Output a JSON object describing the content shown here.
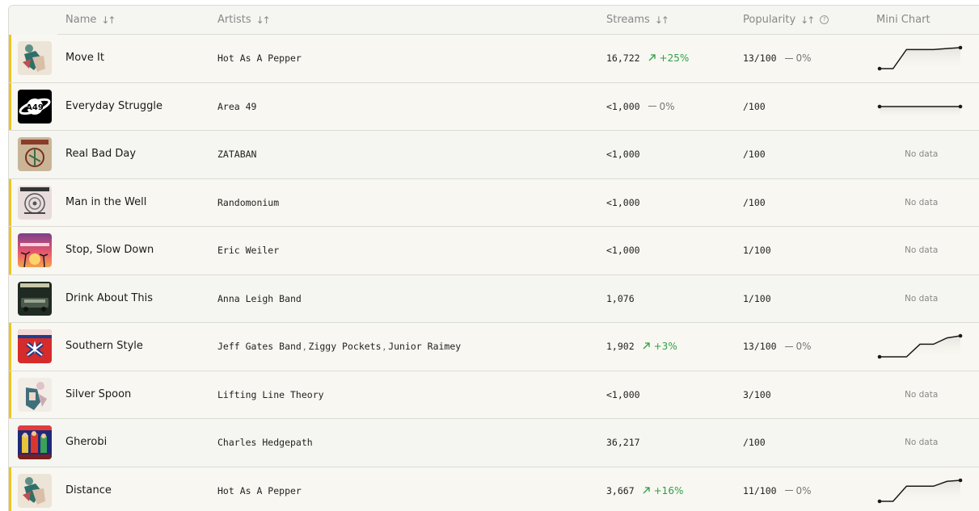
{
  "header": {
    "name": "Name",
    "artists": "Artists",
    "streams": "Streams",
    "popularity": "Popularity",
    "mini_chart": "Mini Chart",
    "info_glyph": "?"
  },
  "no_data_label": "No data",
  "colors": {
    "accent_bar": "#f0c419",
    "positive": "#2f9e4a",
    "row_shaded": "#f8f7f1",
    "row_plain": "#f5f5f2"
  },
  "rows": [
    {
      "name": "Move It",
      "artists": [
        "Hot As A Pepper"
      ],
      "streams": "16,722",
      "streams_change": "+25%",
      "streams_trend": "up",
      "popularity": "13/100",
      "popularity_change": "0%",
      "chart": [
        0.0,
        0.0,
        1.0,
        1.0,
        1.0,
        1.05,
        1.1
      ],
      "highlight": true
    },
    {
      "name": "Everyday Struggle",
      "artists": [
        "Area 49"
      ],
      "streams": "<1,000",
      "streams_change": "0%",
      "streams_trend": "flat",
      "popularity": "/100",
      "popularity_change": "",
      "chart": [
        0.5,
        0.5
      ],
      "highlight": true
    },
    {
      "name": "Real Bad Day",
      "artists": [
        "ZATABAN"
      ],
      "streams": "<1,000",
      "streams_change": "",
      "streams_trend": "",
      "popularity": "/100",
      "popularity_change": "",
      "chart": null,
      "highlight": false
    },
    {
      "name": "Man in the Well",
      "artists": [
        "Randomonium"
      ],
      "streams": "<1,000",
      "streams_change": "",
      "streams_trend": "",
      "popularity": "/100",
      "popularity_change": "",
      "chart": null,
      "highlight": true
    },
    {
      "name": "Stop, Slow Down",
      "artists": [
        "Eric Weiler"
      ],
      "streams": "<1,000",
      "streams_change": "",
      "streams_trend": "",
      "popularity": "1/100",
      "popularity_change": "",
      "chart": null,
      "highlight": true
    },
    {
      "name": "Drink About This",
      "artists": [
        "Anna Leigh Band"
      ],
      "streams": "1,076",
      "streams_change": "",
      "streams_trend": "",
      "popularity": "1/100",
      "popularity_change": "",
      "chart": null,
      "highlight": false
    },
    {
      "name": "Southern Style",
      "artists": [
        "Jeff Gates Band",
        "Ziggy Pockets",
        "Junior Raimey"
      ],
      "streams": "1,902",
      "streams_change": "+3%",
      "streams_trend": "up",
      "popularity": "13/100",
      "popularity_change": "0%",
      "chart": [
        0.0,
        0.0,
        0.0,
        0.6,
        0.6,
        0.9,
        1.0
      ],
      "highlight": true
    },
    {
      "name": "Silver Spoon",
      "artists": [
        "Lifting Line Theory"
      ],
      "streams": "<1,000",
      "streams_change": "",
      "streams_trend": "",
      "popularity": "3/100",
      "popularity_change": "",
      "chart": null,
      "highlight": true
    },
    {
      "name": "Gherobi",
      "artists": [
        "Charles Hedgepath"
      ],
      "streams": "36,217",
      "streams_change": "",
      "streams_trend": "",
      "popularity": "/100",
      "popularity_change": "",
      "chart": null,
      "highlight": false
    },
    {
      "name": "Distance",
      "artists": [
        "Hot As A Pepper"
      ],
      "streams": "3,667",
      "streams_change": "+16%",
      "streams_trend": "up",
      "popularity": "11/100",
      "popularity_change": "0%",
      "chart": [
        0.0,
        0.0,
        0.72,
        0.72,
        0.72,
        0.95,
        1.0
      ],
      "highlight": true
    }
  ]
}
